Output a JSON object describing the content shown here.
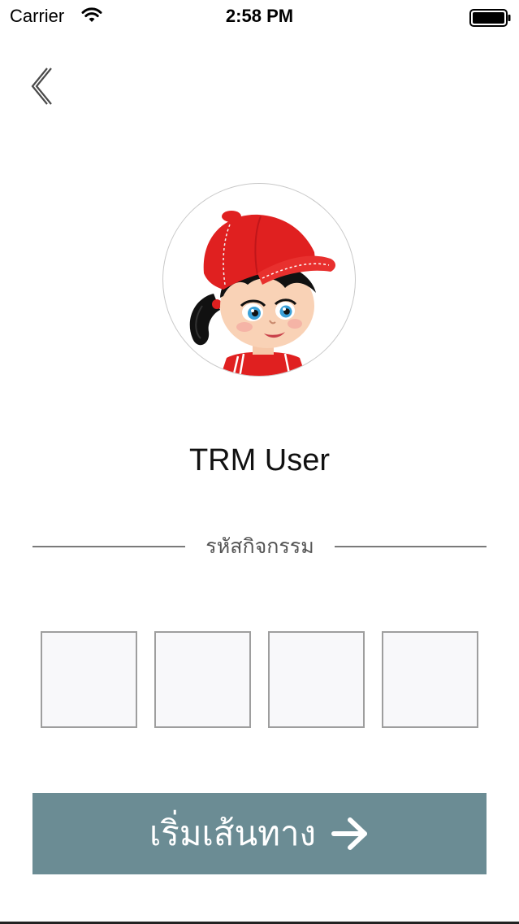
{
  "status_bar": {
    "carrier": "Carrier",
    "time": "2:58 PM"
  },
  "icons": {
    "back": "chevron-left-icon",
    "wifi": "wifi-icon",
    "battery": "battery-icon",
    "arrow": "arrow-right-icon"
  },
  "profile": {
    "name": "TRM User"
  },
  "activity_code": {
    "label": "รหัสกิจกรรม",
    "digits": [
      "",
      "",
      "",
      ""
    ]
  },
  "start_button": {
    "label": "เริ่มเส้นทาง"
  },
  "colors": {
    "button": "#6b8c94",
    "cap_red": "#e02020"
  }
}
